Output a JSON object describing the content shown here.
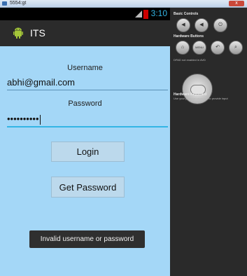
{
  "window": {
    "title": "5554:gt",
    "close_glyph": "x"
  },
  "status_bar": {
    "time": "3:10",
    "signal_icon": "signal-icon",
    "battery_icon": "battery-icon"
  },
  "app": {
    "title": "ITS",
    "icon": "android-icon"
  },
  "form": {
    "username_label": "Username",
    "username_value": "abhi@gmail.com",
    "password_label": "Password",
    "password_value": "••••••••••"
  },
  "buttons": {
    "login": "Login",
    "get_password": "Get Password"
  },
  "toast": {
    "message": "Invalid username or password"
  },
  "side_panel": {
    "basic_controls": "Basic Controls",
    "hardware_buttons": "Hardware Buttons",
    "menu_label": "MENU",
    "dpad_note": "DPAD not enabled in AVD",
    "keyboard_heading": "Hardware Keyboard",
    "keyboard_note": "Use your physical keyboard to provide input"
  },
  "colors": {
    "accent": "#33b5e5",
    "content_bg": "#a4d7f7",
    "actionbar": "#2b2b2b",
    "toast": "#2f2f2f"
  }
}
